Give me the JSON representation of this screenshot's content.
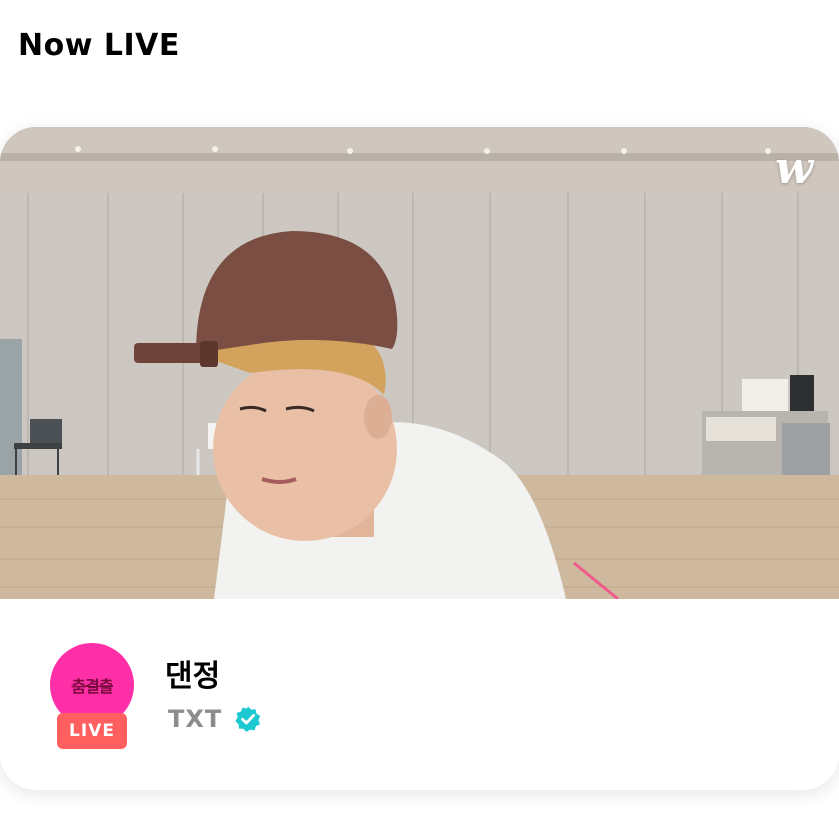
{
  "page": {
    "heading": "Now LIVE"
  },
  "live_card": {
    "brand_logo": "w",
    "stream_title": "댄정",
    "artist_name": "TXT",
    "live_label": "LIVE",
    "avatar_art": "춤결출",
    "verified": true,
    "colors": {
      "avatar_bg": "#ff2fa8",
      "live_badge_bg": "#ff5f5f",
      "verified_badge": "#1ec8d2"
    },
    "icons": {
      "brand": "weverse-logo-icon",
      "verified": "verified-badge-icon"
    }
  }
}
